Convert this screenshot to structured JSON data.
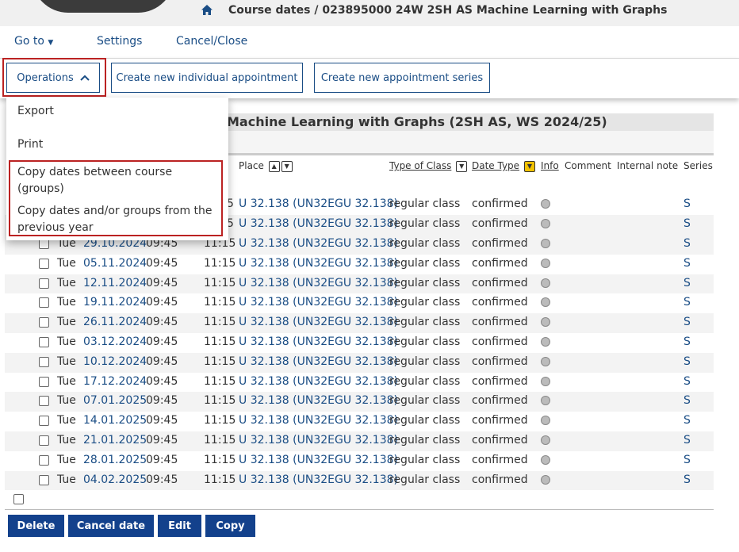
{
  "header": {
    "title": "Course dates",
    "course": "/ 023895000 24W 2SH AS Machine Learning with Graphs"
  },
  "nav": {
    "goto": "Go to",
    "settings": "Settings",
    "cancel_close": "Cancel/Close"
  },
  "toolbar": {
    "operations": "Operations",
    "new_individual": "Create new individual appointment",
    "new_series": "Create new appointment series"
  },
  "menu": {
    "export": "Export",
    "print": "Print",
    "copy_groups": "Copy dates between course (groups)",
    "copy_prev_year": "Copy dates and/or groups from the previous year"
  },
  "section": {
    "title": "Machine Learning with Graphs (2SH AS, WS 2024/25)"
  },
  "table": {
    "headers": {
      "place": "Place",
      "type_of_class": "Type of Class",
      "date_type": "Date Type",
      "info": "Info",
      "comment": "Comment",
      "internal_note": "Internal note",
      "series": "Series"
    },
    "hidden_rows": [
      {
        "end": "5",
        "place": "U 32.138 (UN32EGU 32.138)",
        "type": "regular class",
        "status": "confirmed",
        "series": "S"
      },
      {
        "end": "5",
        "place": "U 32.138 (UN32EGU 32.138)",
        "type": "regular class",
        "status": "confirmed",
        "series": "S"
      }
    ],
    "rows": [
      {
        "day": "Tue",
        "date": "29.10.2024",
        "start": "09:45",
        "end": "11:15",
        "place": "U 32.138 (UN32EGU 32.138)",
        "type": "regular class",
        "status": "confirmed",
        "series": "S"
      },
      {
        "day": "Tue",
        "date": "05.11.2024",
        "start": "09:45",
        "end": "11:15",
        "place": "U 32.138 (UN32EGU 32.138)",
        "type": "regular class",
        "status": "confirmed",
        "series": "S"
      },
      {
        "day": "Tue",
        "date": "12.11.2024",
        "start": "09:45",
        "end": "11:15",
        "place": "U 32.138 (UN32EGU 32.138)",
        "type": "regular class",
        "status": "confirmed",
        "series": "S"
      },
      {
        "day": "Tue",
        "date": "19.11.2024",
        "start": "09:45",
        "end": "11:15",
        "place": "U 32.138 (UN32EGU 32.138)",
        "type": "regular class",
        "status": "confirmed",
        "series": "S"
      },
      {
        "day": "Tue",
        "date": "26.11.2024",
        "start": "09:45",
        "end": "11:15",
        "place": "U 32.138 (UN32EGU 32.138)",
        "type": "regular class",
        "status": "confirmed",
        "series": "S"
      },
      {
        "day": "Tue",
        "date": "03.12.2024",
        "start": "09:45",
        "end": "11:15",
        "place": "U 32.138 (UN32EGU 32.138)",
        "type": "regular class",
        "status": "confirmed",
        "series": "S"
      },
      {
        "day": "Tue",
        "date": "10.12.2024",
        "start": "09:45",
        "end": "11:15",
        "place": "U 32.138 (UN32EGU 32.138)",
        "type": "regular class",
        "status": "confirmed",
        "series": "S"
      },
      {
        "day": "Tue",
        "date": "17.12.2024",
        "start": "09:45",
        "end": "11:15",
        "place": "U 32.138 (UN32EGU 32.138)",
        "type": "regular class",
        "status": "confirmed",
        "series": "S"
      },
      {
        "day": "Tue",
        "date": "07.01.2025",
        "start": "09:45",
        "end": "11:15",
        "place": "U 32.138 (UN32EGU 32.138)",
        "type": "regular class",
        "status": "confirmed",
        "series": "S"
      },
      {
        "day": "Tue",
        "date": "14.01.2025",
        "start": "09:45",
        "end": "11:15",
        "place": "U 32.138 (UN32EGU 32.138)",
        "type": "regular class",
        "status": "confirmed",
        "series": "S"
      },
      {
        "day": "Tue",
        "date": "21.01.2025",
        "start": "09:45",
        "end": "11:15",
        "place": "U 32.138 (UN32EGU 32.138)",
        "type": "regular class",
        "status": "confirmed",
        "series": "S"
      },
      {
        "day": "Tue",
        "date": "28.01.2025",
        "start": "09:45",
        "end": "11:15",
        "place": "U 32.138 (UN32EGU 32.138)",
        "type": "regular class",
        "status": "confirmed",
        "series": "S"
      },
      {
        "day": "Tue",
        "date": "04.02.2025",
        "start": "09:45",
        "end": "11:15",
        "place": "U 32.138 (UN32EGU 32.138)",
        "type": "regular class",
        "status": "confirmed",
        "series": "S"
      }
    ]
  },
  "actions": {
    "delete": "Delete",
    "cancel_date": "Cancel date",
    "edit": "Edit",
    "copy": "Copy"
  }
}
